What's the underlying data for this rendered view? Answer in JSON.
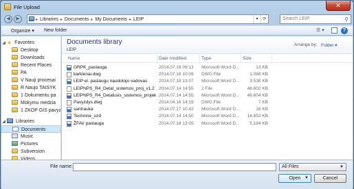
{
  "window": {
    "title": "File Upload",
    "close_glyph": "✕"
  },
  "address": {
    "segments": [
      "Libraries",
      "Documents",
      "My Documents",
      "LEIP"
    ],
    "separator": "▸"
  },
  "search": {
    "placeholder": "Search LEIP"
  },
  "toolbar": {
    "organize_label": "Organize ▾",
    "new_folder_label": "New folder"
  },
  "nav": {
    "items": [
      {
        "label": "Favorites",
        "icon": "star-icon",
        "kind": "header"
      },
      {
        "label": "Desktop",
        "icon": "folder-icon"
      },
      {
        "label": "Downloads",
        "icon": "folder-icon"
      },
      {
        "label": "Recent Places",
        "icon": "folder-icon"
      },
      {
        "label": "PA",
        "icon": "folder-icon"
      },
      {
        "label": "V Nauji procesai",
        "icon": "folder-icon"
      },
      {
        "label": "R Naujo TAISYK",
        "icon": "folder-icon"
      },
      {
        "label": "1 Dokumentu pa",
        "icon": "folder-icon"
      },
      {
        "label": "Mokymu medzia",
        "icon": "folder-icon"
      },
      {
        "label": "1 ZKOP GIS pavyz",
        "icon": "folder-icon"
      },
      {
        "label": "Libraries",
        "icon": "library-icon",
        "kind": "header"
      },
      {
        "label": "Documents",
        "icon": "documents-icon",
        "selected": true
      },
      {
        "label": "Music",
        "icon": "music-icon"
      },
      {
        "label": "Pictures",
        "icon": "pictures-icon"
      },
      {
        "label": "Subversion",
        "icon": "folder-icon"
      },
      {
        "label": "Videos",
        "icon": "folder-icon"
      }
    ]
  },
  "library": {
    "title": "Documents library",
    "subtitle": "LEIP",
    "arrange_label": "Arrange by:",
    "arrange_value": "Folder ▾"
  },
  "columns": {
    "name": "Name",
    "date": "Date modified",
    "type": "Type",
    "size": "Size"
  },
  "files": [
    {
      "name": "GRPK_paslauga",
      "date": "2014.07.18 09:13",
      "type": "Microsoft Word D...",
      "size": "13 KB",
      "icon": "word"
    },
    {
      "name": "karklenai.dwg",
      "date": "2014.07.16 10:09",
      "type": "DWG File",
      "size": "1.088 KB",
      "icon": "dwg"
    },
    {
      "name": "LEIP el. paslaugu naudotojo vadovas",
      "date": "2014.07.18 13:07",
      "type": "Microsoft Word D...",
      "size": "3.538 KB",
      "icon": "word"
    },
    {
      "name": "LEIPNPS_R4_Detal_sistemos_proj_v1.2",
      "date": "2014.07.14 14:55",
      "type": "2 File",
      "size": "46.602 KB",
      "icon": "file2"
    },
    {
      "name": "LEIPNPS_R4_Detalusis_sistemos_projekta...",
      "date": "2014.07.14 14:55",
      "type": "Microsoft Word D...",
      "size": "46.604 KB",
      "icon": "word"
    },
    {
      "name": "Pavyzdys.dwg",
      "date": "2014.04.16 14:19",
      "type": "DWG File",
      "size": "7 KB",
      "icon": "dwg"
    },
    {
      "name": "santrauka",
      "date": "2014.07.17 10:42",
      "type": "Microsoft Word D...",
      "size": "16 KB",
      "icon": "word"
    },
    {
      "name": "Technine_uzd",
      "date": "2014.07.14 14:50",
      "type": "Microsoft Word D...",
      "size": "16.653 KB",
      "icon": "word"
    },
    {
      "name": "ŽFAV paslauga",
      "date": "2014.07.18 13:05",
      "type": "Microsoft Word D...",
      "size": "5.194 KB",
      "icon": "word"
    }
  ],
  "bottom": {
    "filename_label": "File name:",
    "filename_value": "",
    "filter_value": "All Files",
    "open_label": "Open",
    "cancel_label": "Cancel"
  }
}
